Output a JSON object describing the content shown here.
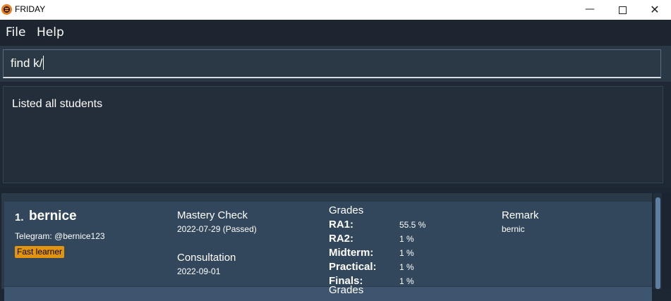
{
  "window": {
    "title": "FRIDAY",
    "minimize": "—",
    "close": "✕"
  },
  "menu": {
    "file": "File",
    "help": "Help"
  },
  "command": {
    "value": "find k/"
  },
  "result": {
    "message": "Listed all students"
  },
  "students": [
    {
      "index": "1.",
      "name": "bernice",
      "telegram": "Telegram: @bernice123",
      "tag": "Fast learner",
      "mastery_title": "Mastery Check",
      "mastery_value": "2022-07-29 (Passed)",
      "consultation_title": "Consultation",
      "consultation_value": "2022-09-01",
      "grades_title": "Grades",
      "grades": [
        {
          "label": "RA1:",
          "value": "55.5 %"
        },
        {
          "label": "RA2:",
          "value": "1 %"
        },
        {
          "label": "Midterm:",
          "value": "1 %"
        },
        {
          "label": "Practical:",
          "value": "1 %"
        },
        {
          "label": "Finals:",
          "value": "1 %"
        }
      ],
      "remark_title": "Remark",
      "remark_value": "bernic"
    },
    {
      "grades_title": "Grades"
    }
  ],
  "colors": {
    "tag": "#e3940f",
    "card": "#33475c",
    "background": "#1d2733"
  }
}
